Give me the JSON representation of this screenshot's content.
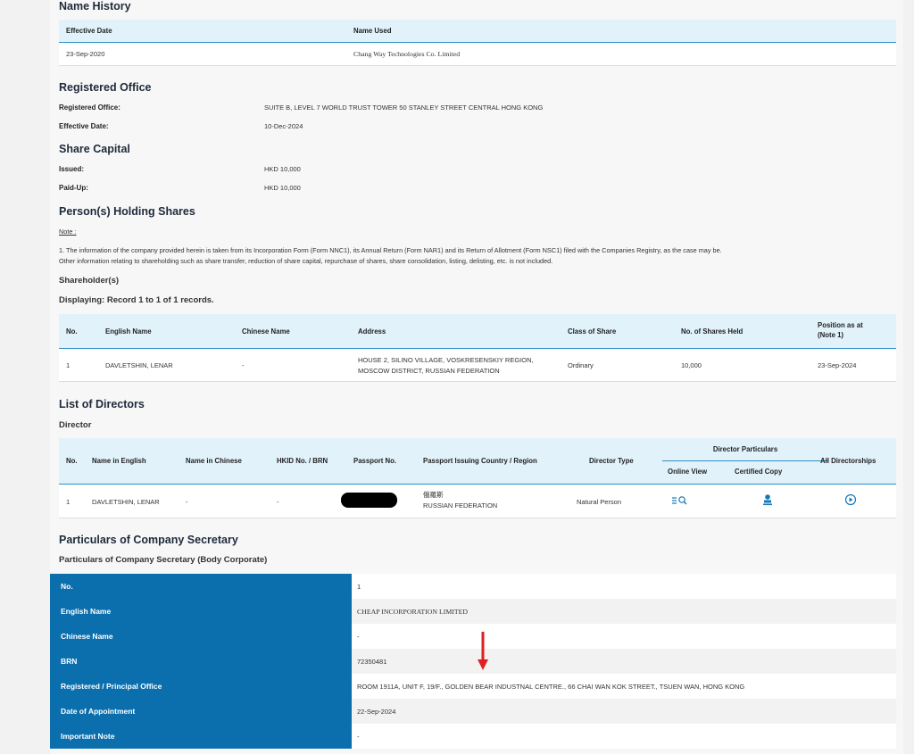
{
  "name_history": {
    "title": "Name History",
    "columns": [
      "Effective Date",
      "Name Used"
    ],
    "rows": [
      {
        "effective_date": "23-Sep-2020",
        "name_used": "Chang Way Technologies Co. Limited"
      }
    ]
  },
  "registered_office": {
    "title": "Registered Office",
    "office_label": "Registered Office:",
    "office_value": "SUITE B, LEVEL 7 WORLD TRUST TOWER 50 STANLEY STREET CENTRAL HONG KONG",
    "date_label": "Effective Date:",
    "date_value": "10-Dec-2024"
  },
  "share_capital": {
    "title": "Share Capital",
    "issued_label": "Issued:",
    "issued_value": "HKD 10,000",
    "paid_label": "Paid-Up:",
    "paid_value": "HKD 10,000"
  },
  "persons_holding": {
    "title": "Person(s) Holding Shares",
    "note_label": "Note :",
    "note_line1": "1. The information of the company provided herein is taken from its Incorporation Form (Form NNC1), its Annual Return (Form NAR1) and its Return of Allotment (Form NSC1) filed with the Companies Registry, as the case may be.",
    "note_line2": "Other information relating to shareholding such as share transfer, reduction of share capital, repurchase of shares, share consolidation, listing, delisting, etc. is not included.",
    "shareholders_title": "Shareholder(s)",
    "displaying": "Displaying: Record 1 to 1 of 1 records.",
    "columns": {
      "no": "No.",
      "english": "English Name",
      "chinese": "Chinese Name",
      "address": "Address",
      "class": "Class of Share",
      "held": "No. of Shares Held",
      "position1": "Position as at",
      "position2": "(Note 1)"
    },
    "rows": [
      {
        "no": "1",
        "english": "DAVLETSHIN, LENAR",
        "chinese": "-",
        "address1": "HOUSE 2, SILINO VILLAGE, VOSKRESENSKIY REGION,",
        "address2": "MOSCOW DISTRICT, RUSSIAN FEDERATION",
        "class": "Ordinary",
        "held": "10,000",
        "position": "23-Sep-2024"
      }
    ]
  },
  "directors": {
    "title": "List of Directors",
    "subtitle": "Director",
    "columns": {
      "no": "No.",
      "english": "Name in English",
      "chinese": "Name in Chinese",
      "hkid": "HKID No. / BRN",
      "passport": "Passport No.",
      "country": "Passport Issuing Country / Region",
      "type": "Director Type",
      "particulars": "Director Particulars",
      "online": "Online View",
      "certified": "Certified Copy",
      "all": "All Directorships"
    },
    "rows": [
      {
        "no": "1",
        "english": "DAVLETSHIN, LENAR",
        "chinese": "-",
        "hkid": "-",
        "country_cn": "俄羅斯",
        "country_en": "RUSSIAN FEDERATION",
        "type": "Natural Person"
      }
    ]
  },
  "secretary": {
    "title": "Particulars of Company Secretary",
    "subtitle": "Particulars of Company Secretary (Body Corporate)",
    "rows": [
      {
        "label": "No.",
        "value": "1"
      },
      {
        "label": "English Name",
        "value": "CHEAP INCORPORATION LIMITED"
      },
      {
        "label": "Chinese Name",
        "value": "-"
      },
      {
        "label": "BRN",
        "value": "72350481"
      },
      {
        "label": "Registered / Principal Office",
        "value": "ROOM 1911A, UNIT F, 19/F., GOLDEN BEAR INDUSTNAL CENTRE., 66 CHAI WAN KOK STREET., TSUEN WAN, HONG KONG"
      },
      {
        "label": "Date of Appointment",
        "value": "22-Sep-2024"
      },
      {
        "label": "Important Note",
        "value": "-"
      }
    ]
  },
  "colors": {
    "accent": "#0b6fae",
    "header_bg": "#e1f2fb",
    "arrow": "#e02020"
  }
}
